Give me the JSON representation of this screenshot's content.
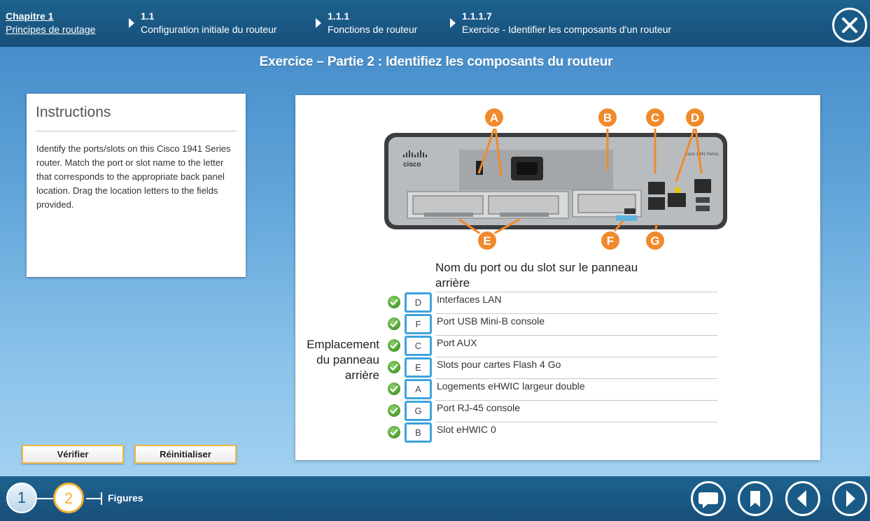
{
  "breadcrumbs": [
    {
      "num": "Chapitre 1",
      "text": "Principes de routage"
    },
    {
      "num": "1.1",
      "text": "Configuration initiale du routeur"
    },
    {
      "num": "1.1.1",
      "text": "Fonctions de routeur"
    },
    {
      "num": "1.1.1.7",
      "text": "Exercice - Identifier les composants d'un routeur"
    }
  ],
  "page_title": "Exercice – Partie 2 : Identifiez les composants du routeur",
  "instructions": {
    "heading": "Instructions",
    "body": "Identify the ports/slots on this Cisco 1941 Series router. Match the port or slot name to the letter that corresponds to the appropriate back panel location. Drag the location letters to the fields provided."
  },
  "buttons": {
    "verify": "Vérifier",
    "reset": "Réinitialiser"
  },
  "figure": {
    "brand": "cisco",
    "series_text": "Cisco 1941 Series",
    "callouts": [
      "A",
      "B",
      "C",
      "D",
      "E",
      "F",
      "G"
    ]
  },
  "table": {
    "header": "Nom du port ou du slot sur le panneau arrière",
    "side_label": "Emplacement du panneau arrière",
    "rows": [
      {
        "letter": "D",
        "label": "Interfaces LAN",
        "correct": true
      },
      {
        "letter": "F",
        "label": "Port USB Mini-B console",
        "correct": true
      },
      {
        "letter": "C",
        "label": "Port AUX",
        "correct": true
      },
      {
        "letter": "E",
        "label": "Slots pour cartes Flash 4 Go",
        "correct": true
      },
      {
        "letter": "A",
        "label": "Logements eHWIC largeur double",
        "correct": true
      },
      {
        "letter": "G",
        "label": "Port RJ-45 console",
        "correct": true
      },
      {
        "letter": "B",
        "label": "Slot eHWIC 0",
        "correct": true
      }
    ]
  },
  "bottom": {
    "steps": [
      "1",
      "2"
    ],
    "figures_label": "Figures",
    "nav_icons": [
      "comment-icon",
      "bookmark-icon",
      "previous-icon",
      "next-icon"
    ]
  },
  "colors": {
    "accent": "#f2b034",
    "topbar": "#1b5a87",
    "callout": "#f08a2c",
    "slot_border": "#3ea3dd",
    "check": "#4a9c2c"
  }
}
